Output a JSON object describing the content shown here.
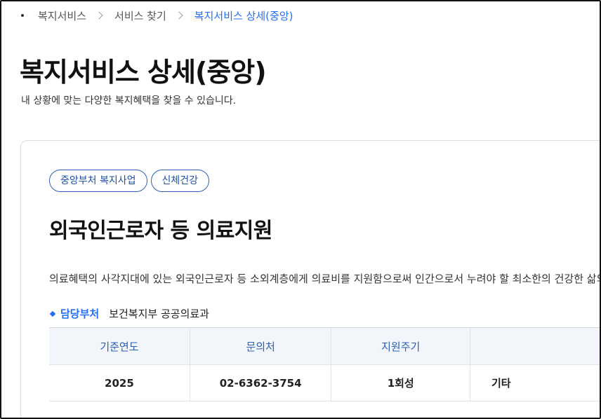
{
  "breadcrumb": {
    "items": [
      "복지서비스",
      "서비스 찾기",
      "복지서비스 상세(중앙)"
    ]
  },
  "header": {
    "title": "복지서비스 상세(중앙)",
    "description": "내 상황에 맞는 다양한 복지혜택을 찾을 수 있습니다."
  },
  "service": {
    "tags": [
      "중앙부처 복지사업",
      "신체건강"
    ],
    "title": "외국인근로자 등 의료지원",
    "description": "의료혜택의 사각지대에 있는 외국인근로자 등 소외계층에게 의료비를 지원함으로써 인간으로서 누려야 할 최소한의 건강한 삶의",
    "department_label": "담당부처",
    "department_value": "보건복지부 공공의료과"
  },
  "table": {
    "headers": [
      "기준연도",
      "문의처",
      "지원주기",
      ""
    ],
    "row": [
      "2025",
      "02-6362-3754",
      "1회성",
      "기타"
    ]
  },
  "colors": {
    "accent": "#256ef4",
    "tag_border": "#2b5fb9",
    "table_header_bg": "#f2f5fa"
  }
}
